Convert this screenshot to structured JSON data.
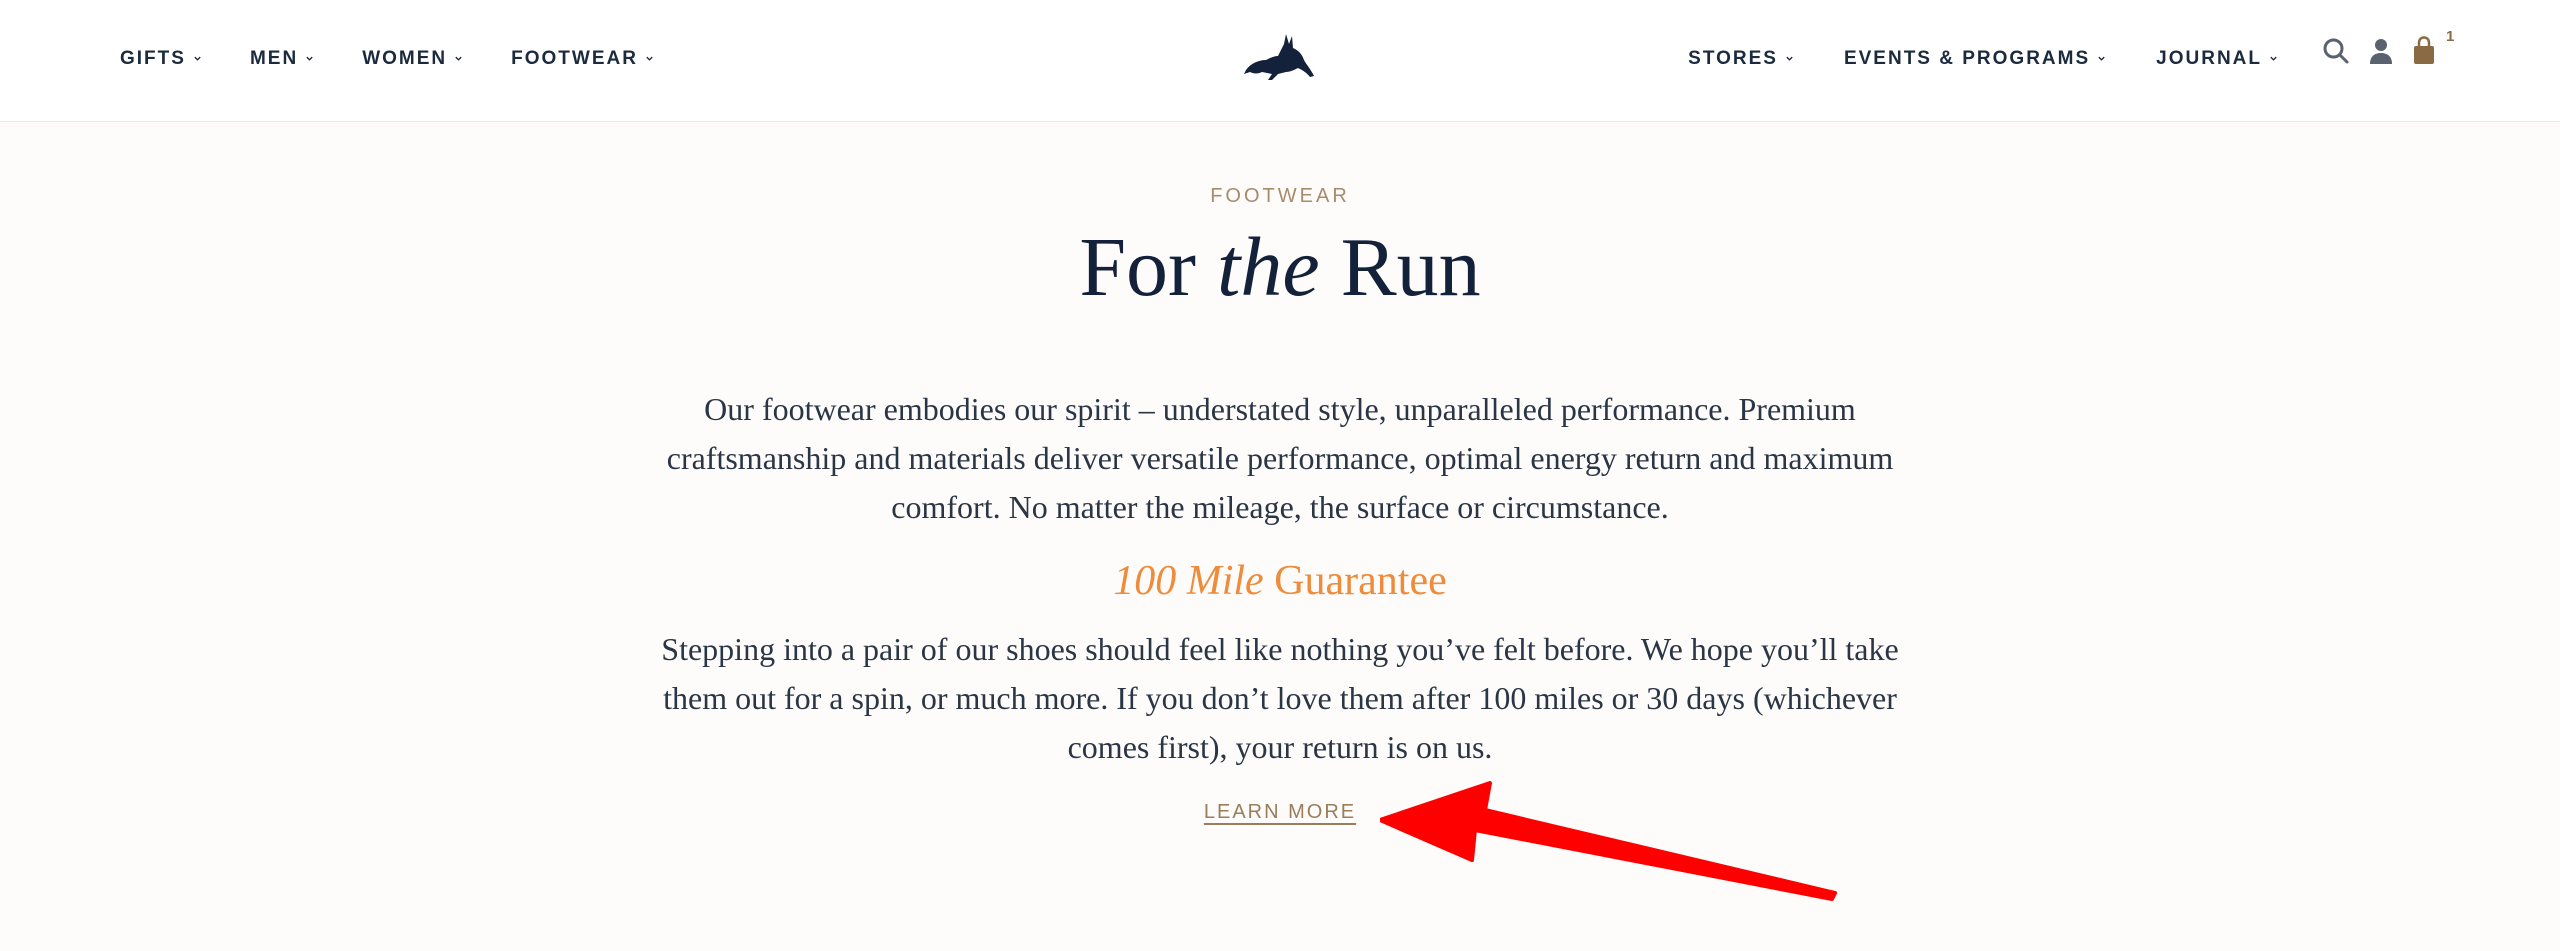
{
  "header": {
    "nav_left": [
      {
        "label": "GIFTS"
      },
      {
        "label": "MEN"
      },
      {
        "label": "WOMEN"
      },
      {
        "label": "FOOTWEAR"
      }
    ],
    "nav_right": [
      {
        "label": "STORES"
      },
      {
        "label": "EVENTS & PROGRAMS"
      },
      {
        "label": "JOURNAL"
      }
    ],
    "cart_count": "1",
    "icons": [
      "search-icon",
      "account-icon",
      "cart-icon",
      "rabbit-logo"
    ]
  },
  "hero": {
    "eyebrow": "FOOTWEAR",
    "headline_pre": "For ",
    "headline_italic": "the",
    "headline_post": " Run",
    "intro": "Our footwear embodies our spirit – understated style, unparalleled performance. Premium craftsmanship and materials deliver versatile performance, optimal energy return and maximum comfort. No matter the mileage, the surface or circumstance.",
    "guarantee_italic": "100 Mile",
    "guarantee_rest": " Guarantee",
    "guarantee_text": "Stepping into a pair of our shoes should feel like nothing you’ve felt before. We hope you’ll take them out for a spin, or much more. If you don’t love them after 100 miles or 30 days (whichever comes first), your return is on us.",
    "learn_more": "LEARN MORE"
  },
  "colors": {
    "navy": "#1b2a3d",
    "gold": "#a78b6a",
    "orange": "#ef8c3c",
    "annotation_red": "#ff0000"
  }
}
